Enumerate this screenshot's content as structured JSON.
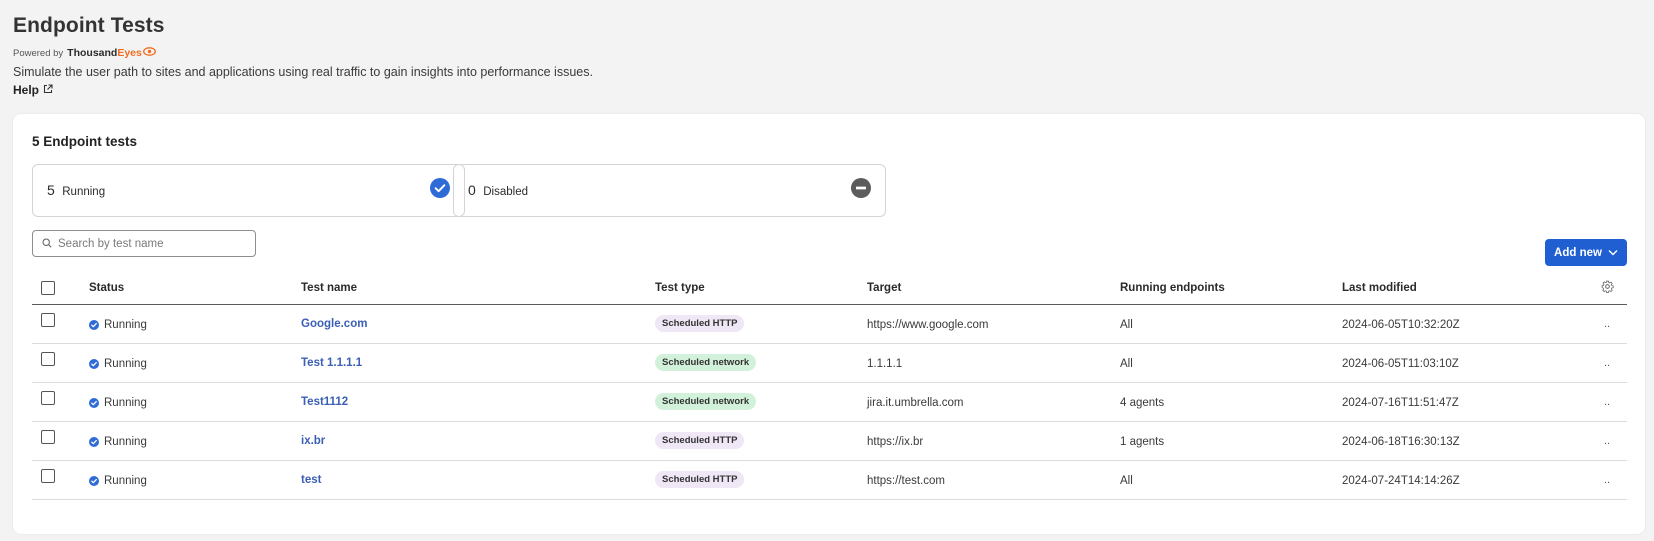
{
  "header": {
    "title": "Endpoint Tests",
    "powered_by": "Powered by",
    "brand_main": "Thousand",
    "brand_accent": "Eyes",
    "description": "Simulate the user path to sites and applications using real traffic to gain insights into performance issues.",
    "help": "Help"
  },
  "summary": {
    "title": "5 Endpoint tests",
    "running_count": "5",
    "running_label": "Running",
    "disabled_count": "0",
    "disabled_label": "Disabled"
  },
  "search": {
    "placeholder": "Search by test name"
  },
  "add_button": {
    "label": "Add new"
  },
  "table": {
    "columns": {
      "status": "Status",
      "name": "Test name",
      "type": "Test type",
      "target": "Target",
      "running": "Running endpoints",
      "modified": "Last modified"
    },
    "rows": [
      {
        "status": "Running",
        "name": "Google.com",
        "type": "Scheduled HTTP",
        "target": "https://www.google.com",
        "running": "All",
        "modified": "2024-06-05T10:32:20Z",
        "more": ".."
      },
      {
        "status": "Running",
        "name": "Test 1.1.1.1",
        "type": "Scheduled network",
        "target": "1.1.1.1",
        "running": "All",
        "modified": "2024-06-05T11:03:10Z",
        "more": ".."
      },
      {
        "status": "Running",
        "name": "Test1112",
        "type": "Scheduled network",
        "target": "jira.it.umbrella.com",
        "running": "4 agents",
        "modified": "2024-07-16T11:51:47Z",
        "more": ".."
      },
      {
        "status": "Running",
        "name": "ix.br",
        "type": "Scheduled HTTP",
        "target": "https://ix.br",
        "running": "1 agents",
        "modified": "2024-06-18T16:30:13Z",
        "more": ".."
      },
      {
        "status": "Running",
        "name": "test",
        "type": "Scheduled HTTP",
        "target": "https://test.com",
        "running": "All",
        "modified": "2024-07-24T14:14:26Z",
        "more": ".."
      }
    ]
  },
  "colors": {
    "accent": "#1f5fd1",
    "link": "#3a5fb4",
    "brand_orange": "#f26b21",
    "pill_http": "#efe6f6",
    "pill_network": "#d2f1da"
  },
  "icons": {
    "status": "check-circle-icon",
    "disabled": "minus-circle-icon",
    "search": "search-icon",
    "help": "external-link-icon",
    "settings": "gear-icon",
    "dropdown": "chevron-down-icon"
  }
}
